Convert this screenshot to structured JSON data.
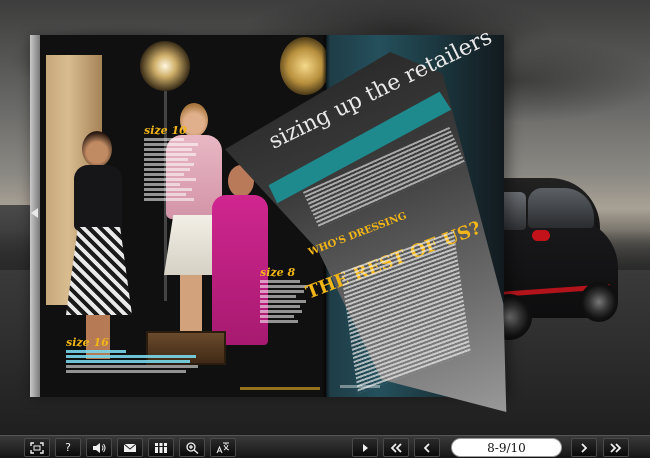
{
  "book": {
    "left_page": {
      "size_tag_a": "size 10",
      "size_tag_b": "size 8",
      "size_tag_c": "size 16"
    },
    "flip_page": {
      "title": "sizing up the retailers",
      "subtitle_small": "WHO'S DRESSING",
      "subtitle_large": "THE REST OF US?"
    }
  },
  "toolbar": {
    "buttons": [
      {
        "name": "fullscreen",
        "icon": "fullscreen-icon"
      },
      {
        "name": "help",
        "label": "?",
        "icon": "help-icon"
      },
      {
        "name": "sound",
        "icon": "speaker-icon"
      },
      {
        "name": "email",
        "icon": "email-icon"
      },
      {
        "name": "thumbnails",
        "icon": "thumbnails-icon"
      },
      {
        "name": "zoom",
        "icon": "zoom-icon"
      },
      {
        "name": "translate",
        "icon": "translate-icon"
      },
      {
        "name": "autoplay",
        "icon": "play-icon"
      },
      {
        "name": "first-page",
        "icon": "double-left-icon"
      },
      {
        "name": "previous-page",
        "icon": "left-icon"
      },
      {
        "name": "next-page",
        "icon": "right-icon"
      },
      {
        "name": "last-page",
        "icon": "double-right-icon"
      }
    ],
    "page_indicator": "8-9/10"
  },
  "colors": {
    "accent_yellow": "#f2b619",
    "accent_teal": "#1f8a8e",
    "toolbar_bg": "#161616"
  }
}
